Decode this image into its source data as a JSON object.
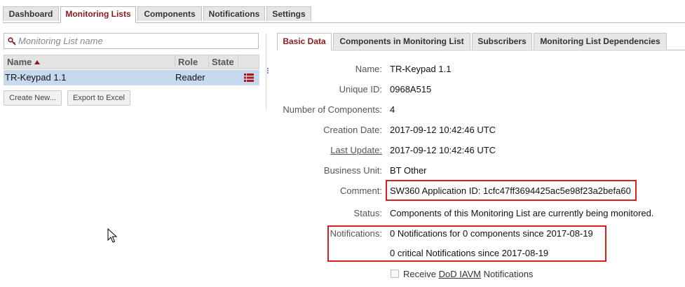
{
  "top_tabs": [
    "Dashboard",
    "Monitoring Lists",
    "Components",
    "Notifications",
    "Settings"
  ],
  "active_top_tab": "Monitoring Lists",
  "search": {
    "placeholder": "Monitoring List name"
  },
  "grid": {
    "columns": [
      "Name",
      "Role",
      "State"
    ],
    "sort_column": "Name",
    "rows": [
      {
        "name": "TR-Keypad 1.1",
        "role": "Reader",
        "state": ""
      }
    ]
  },
  "buttons": {
    "create_new": "Create New...",
    "export": "Export to Excel"
  },
  "detail_tabs": [
    "Basic Data",
    "Components in Monitoring List",
    "Subscribers",
    "Monitoring List Dependencies"
  ],
  "active_detail_tab": "Basic Data",
  "details": {
    "name_label": "Name:",
    "name": "TR-Keypad 1.1",
    "uid_label": "Unique ID:",
    "uid": "0968A515",
    "count_label": "Number of Components:",
    "count": "4",
    "created_label": "Creation Date:",
    "created": "2017-09-12 10:42:46 UTC",
    "updated_label": "Last Update:",
    "updated": "2017-09-12 10:42:46 UTC",
    "bu_label": "Business Unit:",
    "bu": "BT Other",
    "comment_label": "Comment:",
    "comment": "SW360 Application ID: 1cfc47ff3694425ac5e98f23a2befa60",
    "status_label": "Status:",
    "status": "Components of this Monitoring List are currently being monitored.",
    "notifications_label": "Notifications:",
    "notifications_line1": "0 Notifications for 0 components since 2017-08-19",
    "notifications_line2": "0 critical Notifications since 2017-08-19"
  },
  "receive_checkbox": {
    "prefix": "Receive ",
    "link": "DoD IAVM",
    "suffix": " Notifications",
    "checked": false
  },
  "colors": {
    "accent": "#8b1a1a",
    "selection": "#c6d9ef",
    "highlight_box": "#d42020"
  }
}
